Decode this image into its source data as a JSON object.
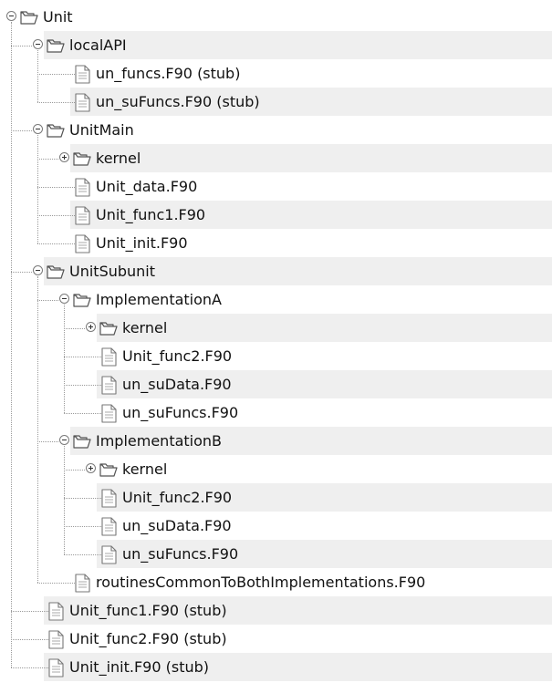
{
  "tree": {
    "nodes": [
      {
        "label": "Unit",
        "type": "folder",
        "depth": 0,
        "expanded": true
      },
      {
        "label": "localAPI",
        "type": "folder",
        "depth": 1,
        "expanded": true
      },
      {
        "label": "un_funcs.F90 (stub)",
        "type": "file",
        "depth": 2
      },
      {
        "label": "un_suFuncs.F90 (stub)",
        "type": "file",
        "depth": 2
      },
      {
        "label": "UnitMain",
        "type": "folder",
        "depth": 1,
        "expanded": true
      },
      {
        "label": "kernel",
        "type": "folder",
        "depth": 2,
        "expanded": false
      },
      {
        "label": "Unit_data.F90",
        "type": "file",
        "depth": 2
      },
      {
        "label": "Unit_func1.F90",
        "type": "file",
        "depth": 2
      },
      {
        "label": "Unit_init.F90",
        "type": "file",
        "depth": 2
      },
      {
        "label": "UnitSubunit",
        "type": "folder",
        "depth": 1,
        "expanded": true
      },
      {
        "label": "ImplementationA",
        "type": "folder",
        "depth": 2,
        "expanded": true
      },
      {
        "label": "kernel",
        "type": "folder",
        "depth": 3,
        "expanded": false
      },
      {
        "label": "Unit_func2.F90",
        "type": "file",
        "depth": 3
      },
      {
        "label": "un_suData.F90",
        "type": "file",
        "depth": 3
      },
      {
        "label": "un_suFuncs.F90",
        "type": "file",
        "depth": 3
      },
      {
        "label": "ImplementationB",
        "type": "folder",
        "depth": 2,
        "expanded": true
      },
      {
        "label": "kernel",
        "type": "folder",
        "depth": 3,
        "expanded": false
      },
      {
        "label": "Unit_func2.F90",
        "type": "file",
        "depth": 3
      },
      {
        "label": "un_suData.F90",
        "type": "file",
        "depth": 3
      },
      {
        "label": "un_suFuncs.F90",
        "type": "file",
        "depth": 3
      },
      {
        "label": "routinesCommonToBothImplementations.F90",
        "type": "file",
        "depth": 2
      },
      {
        "label": "Unit_func1.F90 (stub)",
        "type": "file",
        "depth": 1
      },
      {
        "label": "Unit_func2.F90 (stub)",
        "type": "file",
        "depth": 1
      },
      {
        "label": "Unit_init.F90 (stub)",
        "type": "file",
        "depth": 1
      }
    ]
  },
  "colors": {
    "row_shade": "#efefef",
    "tree_lines": "#9a9a9a",
    "folder_outline": "#555555",
    "file_outline": "#777777"
  }
}
